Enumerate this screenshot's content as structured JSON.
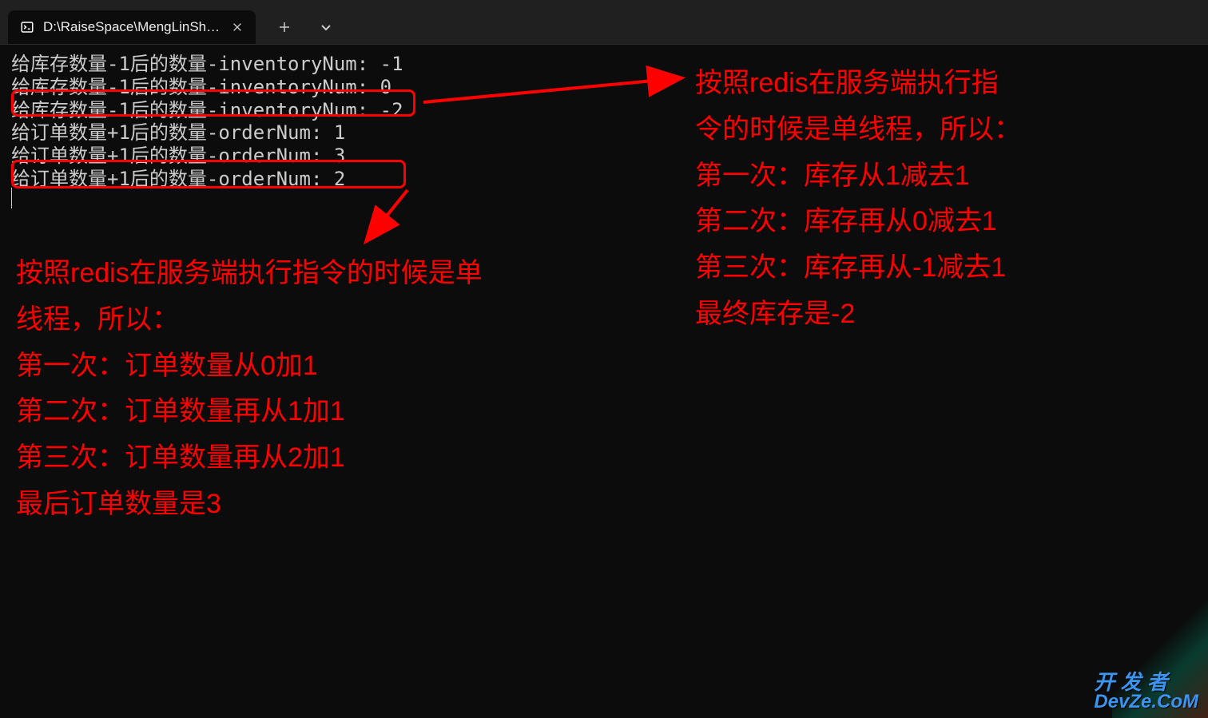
{
  "titlebar": {
    "tab_title": "D:\\RaiseSpace\\MengLinShopp",
    "close_label": "✕",
    "new_tab_label": "＋",
    "dropdown_label": "⌄"
  },
  "terminal": {
    "lines": [
      "给库存数量-1后的数量-inventoryNum: -1",
      "给库存数量-1后的数量-inventoryNum: 0",
      "给库存数量-1后的数量-inventoryNum: -2",
      "给订单数量+1后的数量-orderNum: 1",
      "给订单数量+1后的数量-orderNum: 3",
      "给订单数量+1后的数量-orderNum: 2"
    ]
  },
  "annotations": {
    "right": {
      "line1": "按照redis在服务端执行指",
      "line2": "令的时候是单线程，所以：",
      "line3": "第一次：库存从1减去1",
      "line4": "第二次：库存再从0减去1",
      "line5": "第三次：库存再从-1减去1",
      "line6": "最终库存是-2"
    },
    "left": {
      "line1": "按照redis在服务端执行指令的时候是单",
      "line2": "线程，所以：",
      "line3": "第一次：订单数量从0加1",
      "line4": "第二次：订单数量再从1加1",
      "line5": "第三次：订单数量再从2加1",
      "line6": "最后订单数量是3"
    }
  },
  "watermark": {
    "top": "开 发 者",
    "bottom": "DevZe.CoM"
  }
}
